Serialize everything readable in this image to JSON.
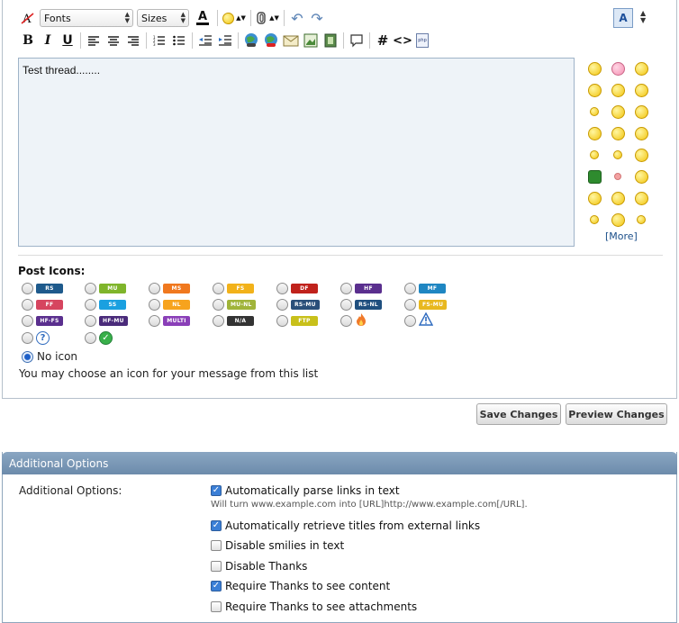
{
  "toolbar": {
    "fonts_label": "Fonts",
    "sizes_label": "Sizes",
    "text_color_glyph": "A",
    "bold_glyph": "B",
    "italic_glyph": "I",
    "underline_glyph": "U",
    "hash_glyph": "#",
    "code_glyph": "<>",
    "php_glyph": "php",
    "switch_mode_glyph": "A"
  },
  "message": {
    "text": "Test thread........"
  },
  "smilies": {
    "more_label": "[More]"
  },
  "post_icons": {
    "title": "Post Icons:",
    "no_icon_label": "No icon",
    "hint": "You may choose an icon for your message from this list",
    "icons": [
      {
        "label": "RS",
        "color": "#1e5a8c"
      },
      {
        "label": "MU",
        "color": "#7fb52b"
      },
      {
        "label": "MS",
        "color": "#f0781e"
      },
      {
        "label": "FS",
        "color": "#f2b21a"
      },
      {
        "label": "DF",
        "color": "#c0221c"
      },
      {
        "label": "HF",
        "color": "#5a2f8e"
      },
      {
        "label": "MF",
        "color": "#1f86c2"
      },
      {
        "label": "FF",
        "color": "#d6455f"
      },
      {
        "label": "SS",
        "color": "#1aa0e0"
      },
      {
        "label": "NL",
        "color": "#f7a31d"
      },
      {
        "label": "MU-NL",
        "color": "#a0b43a"
      },
      {
        "label": "RS-MU",
        "color": "#2a4f7a"
      },
      {
        "label": "RS-NL",
        "color": "#1f4f7f"
      },
      {
        "label": "FS-MU",
        "color": "#e8b81f"
      },
      {
        "label": "HF-FS",
        "color": "#5a2f8e"
      },
      {
        "label": "HF-MU",
        "color": "#4a2b7a"
      },
      {
        "label": "MULTI",
        "color": "#8a3fb8"
      },
      {
        "label": "N/A",
        "color": "#333333"
      },
      {
        "label": "FTP",
        "color": "#c8c01a"
      }
    ]
  },
  "buttons": {
    "save": "Save Changes",
    "preview": "Preview Changes"
  },
  "additional_options": {
    "header": "Additional Options",
    "label": "Additional Options:",
    "hint": "Will turn www.example.com into [URL]http://www.example.com[/URL].",
    "items": [
      {
        "label": "Automatically parse links in text",
        "checked": true
      },
      {
        "label": "Automatically retrieve titles from external links",
        "checked": true
      },
      {
        "label": "Disable smilies in text",
        "checked": false
      },
      {
        "label": "Disable Thanks",
        "checked": false
      },
      {
        "label": "Require Thanks to see content",
        "checked": true
      },
      {
        "label": "Require Thanks to see attachments",
        "checked": false
      }
    ]
  }
}
